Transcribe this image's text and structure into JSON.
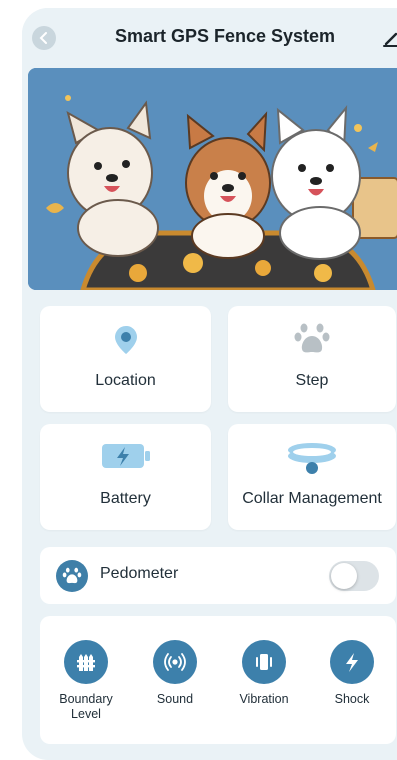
{
  "header": {
    "title": "Smart GPS Fence System"
  },
  "cards": [
    {
      "label": "Location",
      "icon": "location-pin-icon"
    },
    {
      "label": "Step",
      "icon": "paw-icon"
    },
    {
      "label": "Battery",
      "icon": "battery-icon"
    },
    {
      "label": "Collar Management",
      "icon": "collar-icon"
    }
  ],
  "pedometer": {
    "label": "Pedometer",
    "enabled": false
  },
  "modes": [
    {
      "label": "Boundary Level",
      "icon": "fence-icon"
    },
    {
      "label": "Sound",
      "icon": "sound-icon"
    },
    {
      "label": "Vibration",
      "icon": "vibration-icon"
    },
    {
      "label": "Shock",
      "icon": "lightning-icon"
    }
  ],
  "colors": {
    "accent": "#3d80ab",
    "background": "#eaf2f6",
    "banner_sky": "#5a8fbd",
    "icon_light": "#9fd0ec"
  }
}
